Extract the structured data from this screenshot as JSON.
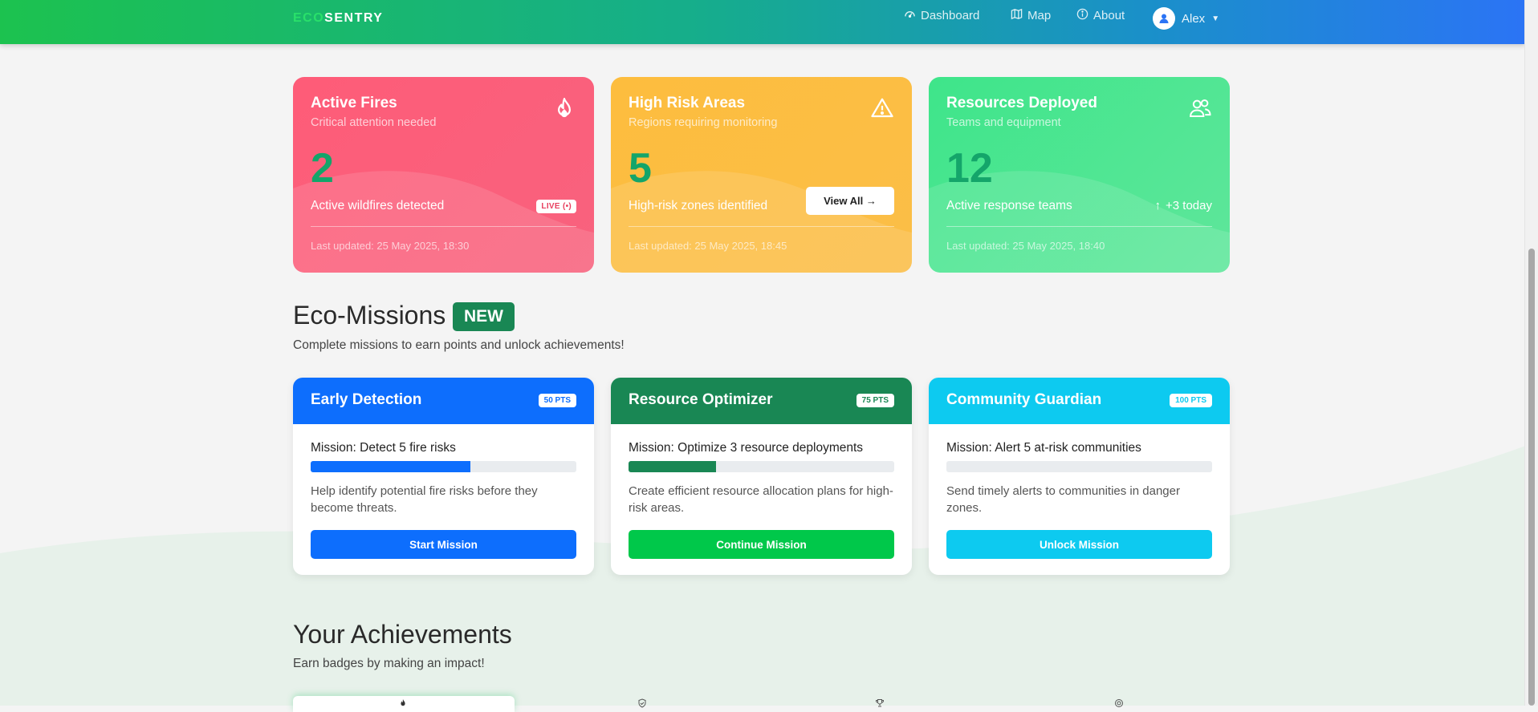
{
  "navbar": {
    "brand_eco": "ECO",
    "brand_sentry": "SENTRY",
    "links": [
      {
        "label": "Dashboard",
        "icon": "dashboard-icon"
      },
      {
        "label": "Map",
        "icon": "map-icon"
      },
      {
        "label": "About",
        "icon": "info-icon"
      }
    ],
    "user": {
      "name": "Alex",
      "icon": "user-icon"
    }
  },
  "stats": [
    {
      "title": "Active Fires",
      "subtitle": "Critical attention needed",
      "icon": "fire-icon",
      "value": "2",
      "description": "Active wildfires detected",
      "badge": "LIVE",
      "updated": "Last updated: 25 May 2025, 18:30",
      "color": "#fe5c78"
    },
    {
      "title": "High Risk Areas",
      "subtitle": "Regions requiring monitoring",
      "icon": "warning-icon",
      "value": "5",
      "description": "High-risk zones identified",
      "button": "View All →",
      "updated": "Last updated: 25 May 2025, 18:45",
      "color": "#fdbd3e"
    },
    {
      "title": "Resources Deployed",
      "subtitle": "Teams and equipment",
      "icon": "people-icon",
      "value": "12",
      "description": "Active response teams",
      "trend": "+3 today",
      "updated": "Last updated: 25 May 2025, 18:40",
      "color": "#3ee58a"
    }
  ],
  "missions_section": {
    "title": "Eco-Missions",
    "badge": "NEW",
    "subtitle": "Complete missions to earn points and unlock achievements!"
  },
  "missions": [
    {
      "name": "Early Detection",
      "points": "50 PTS",
      "goal": "Mission: Detect 5 fire risks",
      "progress": 0.6,
      "description": "Help identify potential fire risks before they become threats.",
      "button": "Start Mission",
      "color": "#0d6efd"
    },
    {
      "name": "Resource Optimizer",
      "points": "75 PTS",
      "goal": "Mission: Optimize 3 resource deployments",
      "progress": 0.33,
      "description": "Create efficient resource allocation plans for high-risk areas.",
      "button": "Continue Mission",
      "color": "#198754"
    },
    {
      "name": "Community Guardian",
      "points": "100 PTS",
      "goal": "Mission: Alert 5 at-risk communities",
      "progress": 0,
      "description": "Send timely alerts to communities in danger zones.",
      "button": "Unlock Mission",
      "color": "#0dcaf0"
    }
  ],
  "achievements_section": {
    "title": "Your Achievements",
    "subtitle": "Earn badges by making an impact!",
    "badge_icons": [
      "fire-icon",
      "shield-icon",
      "trophy-icon",
      "target-icon"
    ]
  }
}
